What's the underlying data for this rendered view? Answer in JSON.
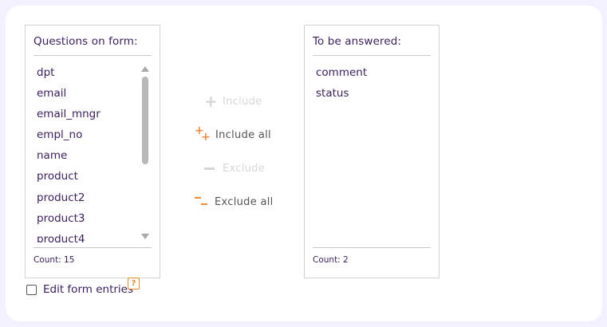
{
  "left_list": {
    "title": "Questions on form:",
    "items": [
      "dpt",
      "email",
      "email_mngr",
      "empl_no",
      "name",
      "product",
      "product2",
      "product3",
      "product4"
    ],
    "count": "Count: 15"
  },
  "right_list": {
    "title": "To be answered:",
    "items": [
      "comment",
      "status"
    ],
    "count": "Count: 2"
  },
  "actions": {
    "include": "Include",
    "include_all": "Include all",
    "exclude": "Exclude",
    "exclude_all": "Exclude all"
  },
  "edit_form": {
    "label": "Edit form entries",
    "checked": false,
    "help": "?"
  },
  "colors": {
    "accent": "#f08a3c",
    "text": "#3a1f5c",
    "background": "#f3f1fd"
  },
  "icons": [
    "plus-icon",
    "plus-plus-icon",
    "minus-icon",
    "minus-minus-icon",
    "scroll-up-icon",
    "scroll-down-icon",
    "help-icon"
  ]
}
